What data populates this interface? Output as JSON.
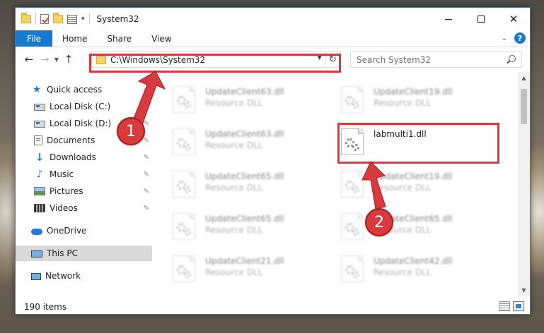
{
  "window": {
    "title": "System32",
    "controls": {
      "minimize": "minimize",
      "maximize": "maximize",
      "close": "close"
    }
  },
  "ribbon": {
    "tabs": [
      "File",
      "Home",
      "Share",
      "View"
    ],
    "help_glyph": "?"
  },
  "address": {
    "path": "C:\\Windows\\System32",
    "refresh_glyph": "↻",
    "search_placeholder": "Search System32"
  },
  "nav_buttons": {
    "back": "←",
    "forward": "→",
    "up": "↑",
    "recent": "⌄"
  },
  "navpane": {
    "items": [
      {
        "label": "Quick access",
        "icon": "star-icon",
        "pinned": false
      },
      {
        "label": "Local Disk (C:)",
        "icon": "disk-icon",
        "pinned": true
      },
      {
        "label": "Local Disk (D:)",
        "icon": "disk-icon",
        "pinned": true
      },
      {
        "label": "Documents",
        "icon": "documents-icon",
        "pinned": true
      },
      {
        "label": "Downloads",
        "icon": "downloads-icon",
        "pinned": true
      },
      {
        "label": "Music",
        "icon": "music-icon",
        "pinned": true
      },
      {
        "label": "Pictures",
        "icon": "pictures-icon",
        "pinned": true
      },
      {
        "label": "Videos",
        "icon": "videos-icon",
        "pinned": true
      },
      {
        "label": "OneDrive",
        "icon": "onedrive-icon",
        "pinned": false
      },
      {
        "label": "This PC",
        "icon": "this-pc-icon",
        "pinned": false,
        "selected": true
      },
      {
        "label": "Network",
        "icon": "network-icon",
        "pinned": false
      }
    ],
    "pin_glyph": "📌"
  },
  "files": [
    {
      "name": "UpdateClient63.dll",
      "type": "Resource DLL",
      "blurred": true
    },
    {
      "name": "UpdateClient19.dll",
      "type": "Resource DLL",
      "blurred": true
    },
    {
      "name": "UpdateClient63.dll",
      "type": "Resource DLL",
      "blurred": true
    },
    {
      "name": "labmulti1.dll",
      "type": "",
      "blurred": false
    },
    {
      "name": "UpdateClient65.dll",
      "type": "Resource DLL",
      "blurred": true
    },
    {
      "name": "UpdateClient19.dll",
      "type": "Resource DLL",
      "blurred": true
    },
    {
      "name": "UpdateClient65.dll",
      "type": "Resource DLL",
      "blurred": true
    },
    {
      "name": "UpdateClient65.dll",
      "type": "Resource DLL",
      "blurred": true
    },
    {
      "name": "UpdateClient21.dll",
      "type": "Resource DLL",
      "blurred": true
    },
    {
      "name": "UpdateClient42.dll",
      "type": "Resource DLL",
      "blurred": true
    }
  ],
  "status": {
    "item_count": "190 items"
  },
  "annotations": {
    "callout_1": "1",
    "callout_2": "2",
    "highlight_color": "#d9363e"
  },
  "colors": {
    "accent": "#1979ca",
    "callout": "#d93a3d"
  }
}
